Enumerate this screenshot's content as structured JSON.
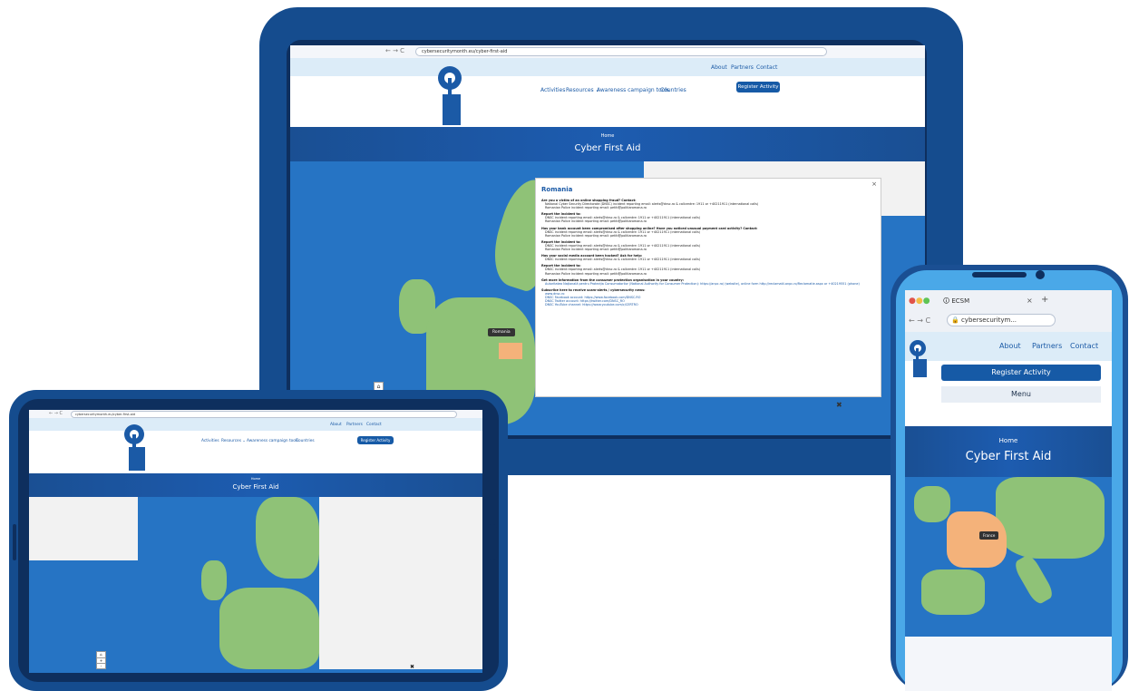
{
  "laptop": {
    "url": "cybersecuritymonth.eu/cyber-first-aid",
    "topnav": [
      "About",
      "Partners",
      "Contact"
    ],
    "mainnav": [
      "Activities",
      "Resources ⌄",
      "Awareness campaign tools",
      "Countries"
    ],
    "register": "Register Activity",
    "breadcrumb": "Home",
    "title": "Cyber First Aid",
    "tooltip": "Romania",
    "popup": {
      "country": "Romania",
      "close": "×",
      "sections": [
        {
          "h": "Are you a victim of an online shopping fraud? Contact:",
          "lines": [
            "National Cyber Security Directorate (DNSC) incident reporting email: alerts@dnsc.ro & callcentre: 1911 or +40211911 (international calls)",
            "Romanian Police incident reporting email: petiti@politiaromana.ro"
          ]
        },
        {
          "h": "Report the incident to:",
          "lines": [
            "DNSC incident reporting email: alerts@dnsc.ro & callcentre: 1911 or +40211911 (international calls)",
            "Romanian Police incident reporting email: petiti@politiaromana.ro"
          ]
        },
        {
          "h": "Has your bank account been compromised after shopping online? Have you noticed unusual payment card activity? Contact:",
          "lines": [
            "DNSC incident reporting email: alerts@dnsc.ro & callcentre: 1911 or +40211911 (international calls)",
            "Romanian Police incident reporting email: petiti@politiaromana.ro"
          ]
        },
        {
          "h": "Report the incident to:",
          "lines": [
            "DNSC incident reporting email: alerts@dnsc.ro & callcentre: 1911 or +40211911 (international calls)",
            "Romanian Police incident reporting email: petiti@politiaromana.ro"
          ]
        },
        {
          "h": "Has your social media account been hacked? Ask for help:",
          "lines": [
            "DNSC incident reporting email: alerts@dnsc.ro & callcentre: 1911 or +40211911 (international calls)"
          ]
        },
        {
          "h": "Report the incident to:",
          "lines": [
            "DNSC incident reporting email: alerts@dnsc.ro & callcentre: 1911 or +40211911 (international calls)",
            "Romanian Police incident reporting email: petiti@politiaromana.ro"
          ]
        },
        {
          "h": "Get more information from the consumer protection organisation in your country:",
          "lines": [
            "Autoritatea Națională pentru Protecția Consumatorilor (National Authority for Consumer Protection): https://anpc.ro/ (website), online form http://reclamatii.anpc.ro/Reclamatie.aspx or +40219551 (phone)"
          ]
        },
        {
          "h": "Subscribe here to receive scam-alerts / cybersecurity news:",
          "lines": [
            "www.dnsc.ro",
            "DNSC Facebook account: https://www.facebook.com/DNSC.RO",
            "DNSC Twitter account: https://twitter.com/DNSC_RO",
            "DNSC YouTube channel: https://www.youtube.com/c/CERTRO"
          ]
        }
      ]
    }
  },
  "tablet": {
    "url": "cybersecuritymonth.eu/cyber-first-aid",
    "topnav": [
      "About",
      "Partners",
      "Contact"
    ],
    "mainnav": [
      "Activities",
      "Resources ⌄",
      "Awareness campaign tools",
      "Countries"
    ],
    "register": "Register Activity",
    "breadcrumb": "Home",
    "title": "Cyber First Aid"
  },
  "phone": {
    "tab_title": "ECSM",
    "url": "cybersecuritym...",
    "topnav": [
      "About",
      "Partners",
      "Contact"
    ],
    "register": "Register Activity",
    "menu": "Menu",
    "breadcrumb": "Home",
    "title": "Cyber First Aid",
    "tooltip": "France"
  },
  "logo_text": [
    "EUROPEAN",
    "CYBER",
    "SECURITY",
    "MONTH"
  ],
  "colors": {
    "brand": "#165aa6",
    "sea": "#2674c4",
    "land": "#8fc277",
    "highlight": "#f4b27a"
  }
}
